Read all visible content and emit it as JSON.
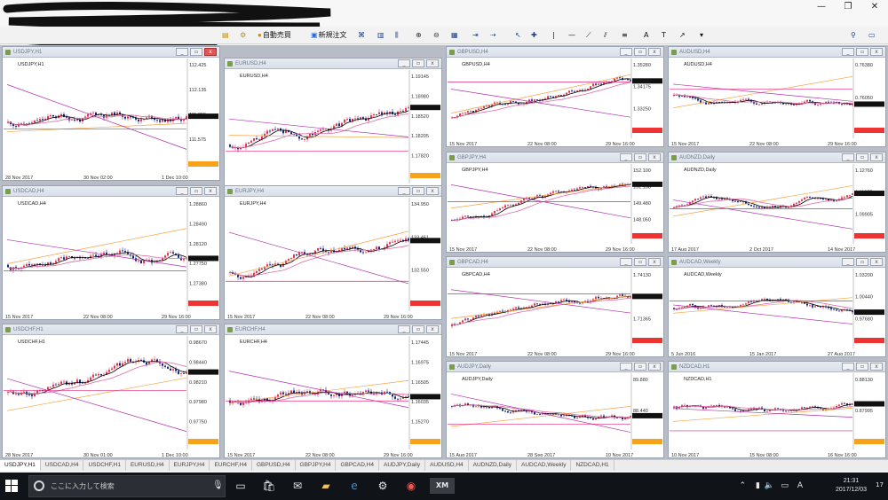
{
  "window_controls": {
    "minimize": "—",
    "maximize": "❐",
    "close": "✕"
  },
  "toolbar": {
    "autotrade_label": "自動売買",
    "neworder_label": "新規注文"
  },
  "charts": [
    {
      "id": "usdjpy",
      "title": "USDJPY,H1",
      "active": true,
      "color": "#8a1e2e",
      "seed": 11,
      "trend": 0.2,
      "prices": [
        "112.425",
        "112.135",
        "111.855",
        "111.575",
        "111.295"
      ],
      "dates": [
        "28 Nov 2017",
        "30 Nov 02:00",
        "1 Dec 10:00"
      ],
      "tag_color": "#f7a21b"
    },
    {
      "id": "eurusd",
      "title": "EURUSD,H4",
      "active": false,
      "color": "#e88",
      "seed": 21,
      "trend": 0.6,
      "prices": [
        "1.19145",
        "1.18980",
        "1.18520",
        "1.18205",
        "1.17820",
        "1.17405"
      ],
      "dates": [
        "15 Nov 2017",
        "22 Nov 08:00",
        "29 Nov 16:00"
      ],
      "tag_color": "#f7a21b"
    },
    {
      "id": "gbpusd",
      "title": "GBPUSD,H4",
      "active": false,
      "color": "#e88",
      "seed": 31,
      "trend": 1.0,
      "prices": [
        "1.35280",
        "1.34175",
        "1.33250",
        "1.32125"
      ],
      "dates": [
        "15 Nov 2017",
        "22 Nov 08:00",
        "29 Nov 16:00"
      ],
      "tag_color": "#e33"
    },
    {
      "id": "audusd",
      "title": "AUDUSD,H4",
      "active": false,
      "color": "#e88",
      "seed": 41,
      "trend": -0.3,
      "prices": [
        "0.76380",
        "0.76050",
        "0.75540"
      ],
      "dates": [
        "15 Nov 2017",
        "22 Nov 08:00",
        "29 Nov 16:00"
      ],
      "tag_color": "#e33"
    },
    {
      "id": "gbpjpy",
      "title": "GBPJPY,H4",
      "active": false,
      "color": "#e88",
      "seed": 51,
      "trend": 0.8,
      "prices": [
        "152.100",
        "151.138",
        "149.480",
        "148.050",
        "147.380"
      ],
      "dates": [
        "15 Nov 2017",
        "22 Nov 08:00",
        "29 Nov 16:00"
      ],
      "tag_color": "#e33"
    },
    {
      "id": "audnzd",
      "title": "AUDNZD,Daily",
      "active": false,
      "color": "#e88",
      "seed": 61,
      "trend": 0.1,
      "prices": [
        "1.12760",
        "1.11375",
        "1.09905",
        "1.08380"
      ],
      "dates": [
        "17 Aug 2017",
        "2 Oct 2017",
        "14 Nov 2017"
      ],
      "tag_color": "#e33"
    },
    {
      "id": "usdcad",
      "title": "USDCAD,H4",
      "active": false,
      "color": "#e88",
      "seed": 71,
      "trend": 0.3,
      "prices": [
        "1.28860",
        "1.28490",
        "1.28120",
        "1.27750",
        "1.27380",
        "1.27010"
      ],
      "dates": [
        "15 Nov 2017",
        "22 Nov 08:00",
        "29 Nov 16:00"
      ],
      "tag_color": "#e33"
    },
    {
      "id": "eurjpy",
      "title": "EURJPY,H4",
      "active": false,
      "color": "#e88",
      "seed": 81,
      "trend": 0.6,
      "prices": [
        "134.950",
        "133.461",
        "132.550",
        "131.560"
      ],
      "dates": [
        "15 Nov 2017",
        "22 Nov 08:00",
        "29 Nov 16:00"
      ],
      "tag_color": "#e33"
    },
    {
      "id": "gbpcad",
      "title": "GBPCAD,H4",
      "active": false,
      "color": "#e88",
      "seed": 91,
      "trend": 0.9,
      "prices": [
        "1.74130",
        "1.72270",
        "1.71365",
        "1.68550"
      ],
      "dates": [
        "15 Nov 2017",
        "22 Nov 08:00",
        "29 Nov 16:00"
      ],
      "tag_color": "#e33"
    },
    {
      "id": "audcad",
      "title": "AUDCAD,Weekly",
      "active": false,
      "color": "#e88",
      "seed": 101,
      "trend": -0.2,
      "prices": [
        "1.03200",
        "1.00440",
        "0.97680",
        "0.94920"
      ],
      "dates": [
        "5 Jun 2016",
        "15 Jan 2017",
        "27 Aug 2017"
      ],
      "tag_color": "#e33"
    },
    {
      "id": "usdchf",
      "title": "USDCHF,H1",
      "active": false,
      "color": "#e88",
      "seed": 111,
      "trend": -0.1,
      "prices": [
        "0.98670",
        "0.98440",
        "0.98210",
        "0.97980",
        "0.97750",
        "0.97520"
      ],
      "dates": [
        "28 Nov 2017",
        "30 Nov 01:00",
        "1 Dec 10:00"
      ],
      "tag_color": "#f7a21b"
    },
    {
      "id": "eurchf",
      "title": "EURCHF,H4",
      "active": false,
      "color": "#e88",
      "seed": 121,
      "trend": 0.2,
      "prices": [
        "1.17445",
        "1.16975",
        "1.16505",
        "1.16035",
        "1.15270",
        "1.14800"
      ],
      "dates": [
        "15 Nov 2017",
        "22 Nov 08:00",
        "29 Nov 16:00"
      ],
      "tag_color": "#f7a21b"
    },
    {
      "id": "audjpy",
      "title": "AUDJPY,Daily",
      "active": false,
      "color": "#e88",
      "seed": 131,
      "trend": -0.5,
      "prices": [
        "89.880",
        "88.440",
        "87.000"
      ],
      "dates": [
        "15 Aug 2017",
        "28 Sep 2017",
        "10 Nov 2017"
      ],
      "tag_color": "#f7a21b"
    },
    {
      "id": "nzdcad",
      "title": "NZDCAD,H1",
      "active": false,
      "color": "#e88",
      "seed": 141,
      "trend": -0.4,
      "prices": [
        "0.88130",
        "0.87995",
        "0.87860"
      ],
      "dates": [
        "10 Nov 2017",
        "15 Nov 08:00",
        "16 Nov 16:00"
      ],
      "tag_color": "#f7a21b"
    }
  ],
  "tabs": [
    {
      "label": "USDJPY,H1",
      "active": true
    },
    {
      "label": "USDCAD,H4",
      "active": false
    },
    {
      "label": "USDCHF,H1",
      "active": false
    },
    {
      "label": "EURUSD,H4",
      "active": false
    },
    {
      "label": "EURJPY,H4",
      "active": false
    },
    {
      "label": "EURCHF,H4",
      "active": false
    },
    {
      "label": "GBPUSD,H4",
      "active": false
    },
    {
      "label": "GBPJPY,H4",
      "active": false
    },
    {
      "label": "GBPCAD,H4",
      "active": false
    },
    {
      "label": "AUDJPY,Daily",
      "active": false
    },
    {
      "label": "AUDUSD,H4",
      "active": false
    },
    {
      "label": "AUDNZD,Daily",
      "active": false
    },
    {
      "label": "AUDCAD,Weekly",
      "active": false
    },
    {
      "label": "NZDCAD,H1",
      "active": false
    }
  ],
  "taskbar": {
    "search_placeholder": "ここに入力して検索",
    "time": "21:31",
    "date": "2017/12/03",
    "ime": "A",
    "notification_count": "17",
    "mt4_label": "XM"
  },
  "colors": {
    "bull": "#2e9b4a",
    "bear": "#d6334b",
    "candle_up": "#e03a53",
    "candle_down": "#1a237e",
    "ma_fast": "#000000",
    "ma_slow": "#e06aa4",
    "trend_orange": "#f5a245"
  }
}
